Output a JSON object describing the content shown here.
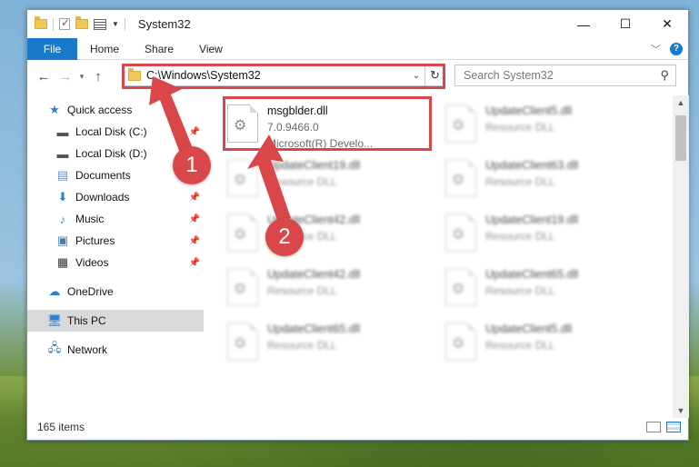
{
  "window": {
    "title": "System32",
    "controls": {
      "minimize": "—",
      "maximize": "☐",
      "close": "✕"
    }
  },
  "ribbon": {
    "tabs": [
      "File",
      "Home",
      "Share",
      "View"
    ],
    "help": "?"
  },
  "navbar": {
    "address": "C:\\Windows\\System32",
    "search_placeholder": "Search System32"
  },
  "navpane": {
    "items": [
      {
        "label": "Quick access",
        "icon": "star-icon"
      },
      {
        "label": "Local Disk (C:)",
        "icon": "drive-icon"
      },
      {
        "label": "Local Disk (D:)",
        "icon": "drive-icon"
      },
      {
        "label": "Documents",
        "icon": "documents-icon"
      },
      {
        "label": "Downloads",
        "icon": "download-icon"
      },
      {
        "label": "Music",
        "icon": "music-icon"
      },
      {
        "label": "Pictures",
        "icon": "pictures-icon"
      },
      {
        "label": "Videos",
        "icon": "videos-icon"
      },
      {
        "label": "OneDrive",
        "icon": "cloud-icon"
      },
      {
        "label": "This PC",
        "icon": "computer-icon"
      },
      {
        "label": "Network",
        "icon": "network-icon"
      }
    ]
  },
  "files": [
    {
      "name": "msgblder.dll",
      "line2": "7.0.9466.0",
      "line3": "Microsoft(R) Develo..."
    },
    {
      "name": "UpdateClient5.dll",
      "line2": "Resource DLL"
    },
    {
      "name": "UpdateClient19.dll",
      "line2": "Resource DLL"
    },
    {
      "name": "UpdateClient63.dll",
      "line2": "Resource DLL"
    },
    {
      "name": "UpdateClient42.dll",
      "line2": "Resource DLL"
    },
    {
      "name": "UpdateClient19.dll",
      "line2": "Resource DLL"
    },
    {
      "name": "UpdateClient42.dll",
      "line2": "Resource DLL"
    },
    {
      "name": "UpdateClient65.dll",
      "line2": "Resource DLL"
    },
    {
      "name": "UpdateClient65.dll",
      "line2": "Resource DLL"
    },
    {
      "name": "UpdateClient5.dll",
      "line2": "Resource DLL"
    }
  ],
  "status": {
    "count": "165 items"
  },
  "annotations": {
    "step1": "1",
    "step2": "2",
    "color": "#d9474a"
  }
}
